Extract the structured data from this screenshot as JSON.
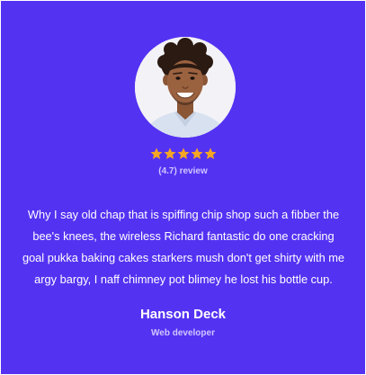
{
  "testimonial": {
    "avatar_icon": "person-photo",
    "rating_value": 4.7,
    "rating_max": 5,
    "star_color": "#f5a623",
    "rating_text": "(4.7) review",
    "quote": "Why I say old chap that is spiffing chip shop such a fibber the bee's knees, the wireless Richard fantastic do one cracking goal pukka baking cakes starkers mush don't get shirty with me argy bargy, I naff chimney pot blimey he lost his bottle cup.",
    "name": "Hanson Deck",
    "role": "Web developer"
  },
  "colors": {
    "background": "#5432f2",
    "muted_text": "#cfc6ff"
  }
}
